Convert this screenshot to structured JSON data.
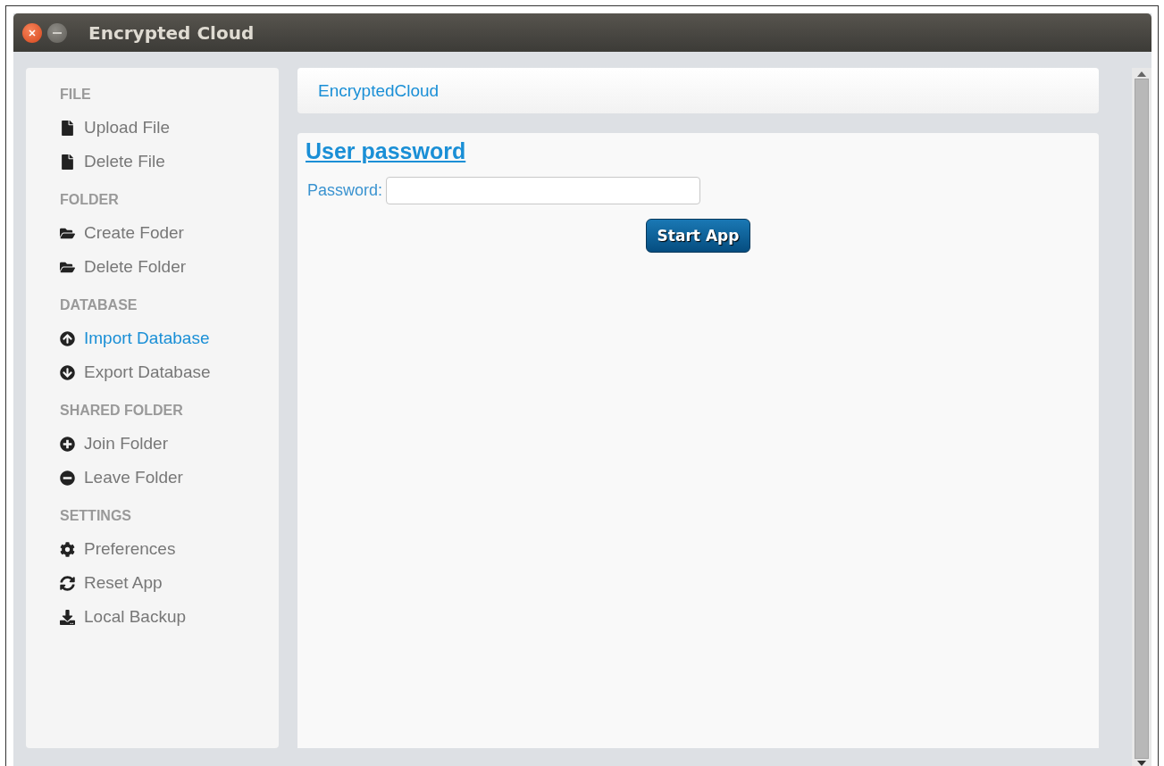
{
  "window": {
    "title": "Encrypted Cloud"
  },
  "sidebar": {
    "sections": [
      {
        "heading": "FILE",
        "items": [
          {
            "kind": "file",
            "label": "Upload File",
            "selected": false
          },
          {
            "kind": "file",
            "label": "Delete File",
            "selected": false
          }
        ]
      },
      {
        "heading": "FOLDER",
        "items": [
          {
            "kind": "folder",
            "label": "Create Foder",
            "selected": false
          },
          {
            "kind": "folder",
            "label": "Delete Folder",
            "selected": false
          }
        ]
      },
      {
        "heading": "DATABASE",
        "items": [
          {
            "kind": "up",
            "label": "Import Database",
            "selected": true
          },
          {
            "kind": "down",
            "label": "Export Database",
            "selected": false
          }
        ]
      },
      {
        "heading": "SHARED FOLDER",
        "items": [
          {
            "kind": "plus",
            "label": "Join Folder",
            "selected": false
          },
          {
            "kind": "minus",
            "label": "Leave Folder",
            "selected": false
          }
        ]
      },
      {
        "heading": "SETTINGS",
        "items": [
          {
            "kind": "gear",
            "label": "Preferences",
            "selected": false
          },
          {
            "kind": "sync",
            "label": "Reset App",
            "selected": false
          },
          {
            "kind": "download",
            "label": "Local Backup",
            "selected": false
          }
        ]
      }
    ]
  },
  "header": {
    "brand": "EncryptedCloud"
  },
  "form": {
    "title": "User password",
    "label": "Password:",
    "button": "Start App"
  }
}
